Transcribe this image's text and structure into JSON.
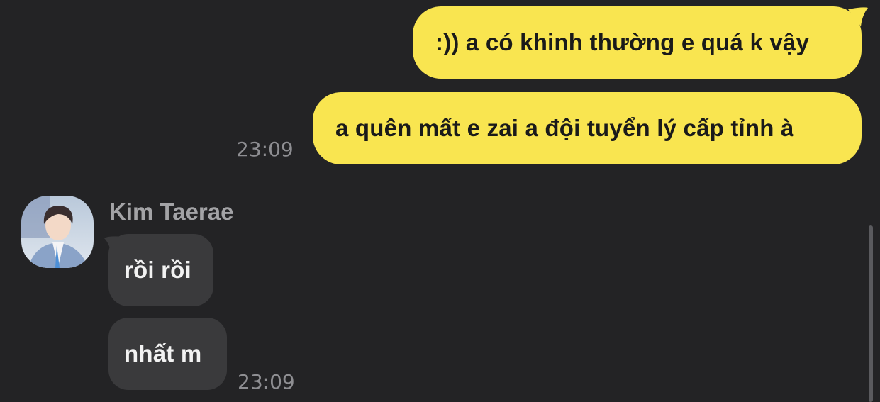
{
  "messages_out": [
    {
      "text": ":)) a có khinh thường e quá k vậy"
    },
    {
      "text": "a quên mất e zai a đội tuyển lý cấp tỉnh à",
      "time": "23:09"
    }
  ],
  "contact": {
    "name": "Kim Taerae"
  },
  "messages_in": [
    {
      "text": "rồi rồi"
    },
    {
      "text": "nhất m",
      "time": "23:09"
    }
  ],
  "colors": {
    "background": "#232325",
    "outgoing_bubble": "#f9e550",
    "incoming_bubble": "#3a3a3c"
  }
}
